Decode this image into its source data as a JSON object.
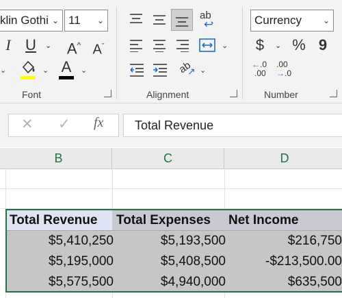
{
  "ribbon": {
    "font": {
      "name": "klin Gothi",
      "size": "11",
      "group_label": "Font",
      "italic": "I",
      "underline": "U",
      "grow": "A",
      "shrink": "A",
      "font_color_letter": "A",
      "fill_color": "#ffff00",
      "font_color": "#000000"
    },
    "alignment": {
      "group_label": "Alignment",
      "wrap_text": "ab"
    },
    "number": {
      "format": "Currency",
      "group_label": "Number",
      "currency_symbol": "$",
      "percent_symbol": "%",
      "comma_symbol": "9",
      "increase_decimal_top": ".0",
      "increase_decimal_bottom": ".00",
      "decrease_decimal_top": ".00",
      "decrease_decimal_bottom": ".0"
    }
  },
  "formula_bar": {
    "cancel_icon": "✕",
    "enter_icon": "✓",
    "fx_label": "fx",
    "value": "Total Revenue"
  },
  "columns": [
    "B",
    "C",
    "D"
  ],
  "table": {
    "headers": [
      "Total Revenue",
      "Total Expenses",
      "Net Income"
    ],
    "rows": [
      [
        "$5,410,250",
        "$5,193,500",
        "$216,750"
      ],
      [
        "$5,195,000",
        "$5,408,500",
        "-$213,500.00"
      ],
      [
        "$5,575,500",
        "$4,940,000",
        "$635,500"
      ]
    ]
  },
  "colors": {
    "accent": "#217346",
    "header_highlight": "#dde3f3"
  }
}
